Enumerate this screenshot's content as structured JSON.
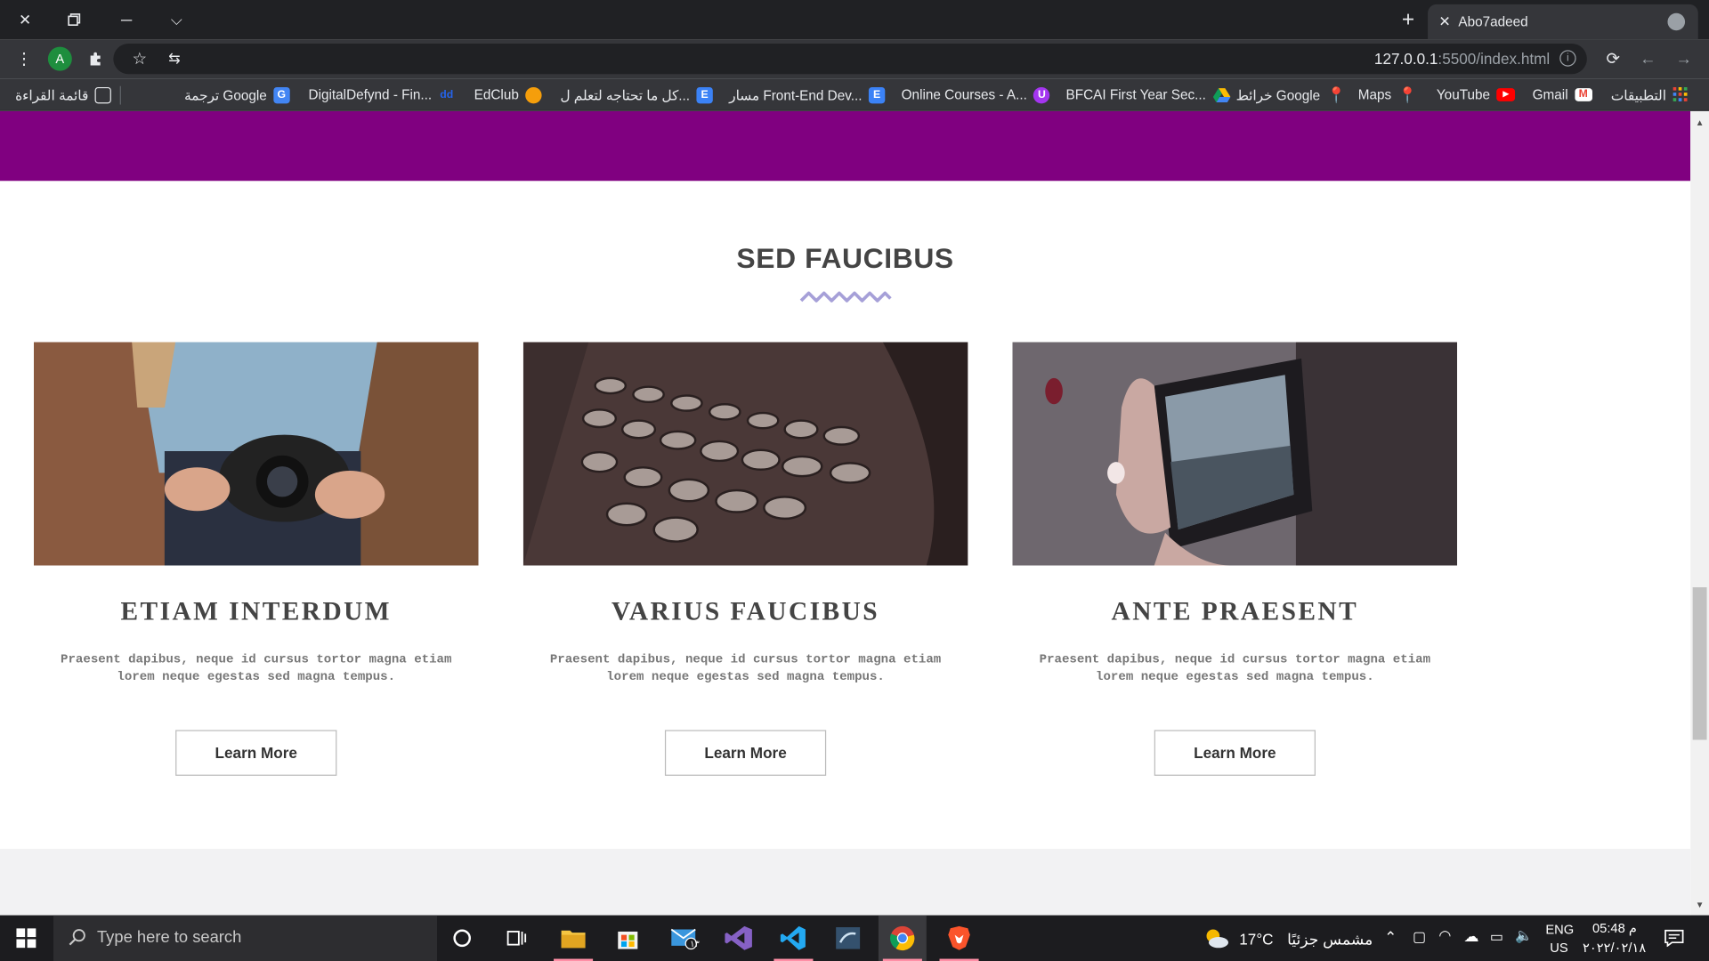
{
  "browser": {
    "tab_title": "Abo7adeed",
    "url_host": "127.0.0.1",
    "url_rest": ":5500/index.html",
    "bookmarks": [
      {
        "label": "التطبيقات",
        "icon": "apps-grid-icon",
        "color": "#ea4335"
      },
      {
        "label": "Gmail",
        "icon": "gmail-icon",
        "color": "#ea4335"
      },
      {
        "label": "YouTube",
        "icon": "youtube-icon",
        "color": "#ff0000"
      },
      {
        "label": "Maps",
        "icon": "maps-pin-icon",
        "color": "#34a853"
      },
      {
        "label": "خرائط Google",
        "icon": "maps-pin-icon",
        "color": "#34a853"
      },
      {
        "label": "BFCAI First Year Sec...",
        "icon": "drive-icon",
        "color": "#fbbc04"
      },
      {
        "label": "Online Courses - A...",
        "icon": "udemy-icon",
        "color": "#a435f0"
      },
      {
        "label": "مسار Front-End Dev...",
        "icon": "e-icon",
        "color": "#3b82f6"
      },
      {
        "label": "كل ما تحتاجه لتعلم ل...",
        "icon": "e-icon",
        "color": "#3b82f6"
      },
      {
        "label": "EdClub",
        "icon": "edclub-icon",
        "color": "#f59e0b"
      },
      {
        "label": "DigitalDefynd - Fin...",
        "icon": "dd-icon",
        "color": "#2563eb"
      },
      {
        "label": "ترجمة Google",
        "icon": "translate-icon",
        "color": "#4285f4"
      },
      {
        "label": "قائمة القراءة",
        "icon": "reading-list-icon",
        "color": "#9aa0a6"
      }
    ]
  },
  "page": {
    "banner_color": "#800080",
    "section_title": "SED FAUCIBUS",
    "cards": [
      {
        "title": "ETIAM INTERDUM",
        "text": "Praesent dapibus, neque id cursus tortor magna etiam lorem neque egestas sed magna tempus.",
        "button": "Learn More",
        "image": "camera-photo"
      },
      {
        "title": "VARIUS FAUCIBUS",
        "text": "Praesent dapibus, neque id cursus tortor magna etiam lorem neque egestas sed magna tempus.",
        "button": "Learn More",
        "image": "typewriter-photo"
      },
      {
        "title": "ANTE PRAESENT",
        "text": "Praesent dapibus, neque id cursus tortor magna etiam lorem neque egestas sed magna tempus.",
        "button": "Learn More",
        "image": "phone-photo"
      }
    ]
  },
  "taskbar": {
    "search_placeholder": "Type here to search",
    "weather_temp": "17°C",
    "weather_text": "مشمس جزئيًا",
    "lang_top": "ENG",
    "lang_bottom": "US",
    "time": "05:48 م",
    "date": "٢٠٢٢/٠٢/١٨",
    "mail_badge": "١٣"
  }
}
